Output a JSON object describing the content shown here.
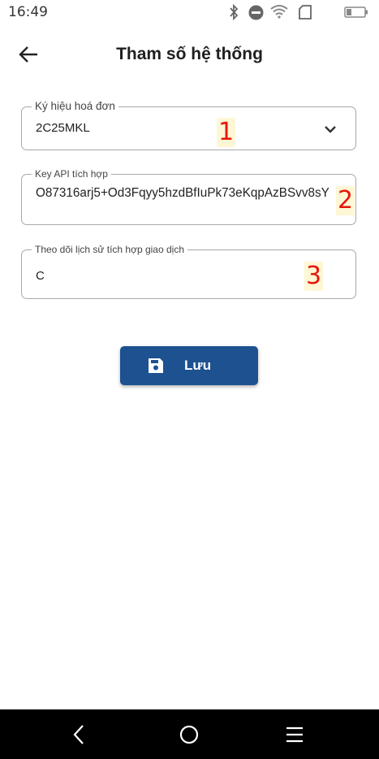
{
  "status_bar": {
    "time": "16:49",
    "icons": [
      "bluetooth-icon",
      "do-not-disturb-icon",
      "wifi-icon",
      "sim-card-icon",
      "battery-icon"
    ]
  },
  "header": {
    "title": "Tham số hệ thống",
    "back_icon": "arrow-left-icon"
  },
  "form": {
    "invoice_symbol": {
      "label": "Ký hiệu hoá đơn",
      "value": "2C25MKL",
      "icon": "chevron-down-icon"
    },
    "api_key": {
      "label": "Key API tích hợp",
      "value": "O87316arj5+Od3Fqyy5hzdBfIuPk73eKqpAzBSvv8sY"
    },
    "transaction_history": {
      "label": "Theo dõi lịch sử tích hợp giao dịch",
      "value": "C"
    }
  },
  "annotations": [
    "1",
    "2",
    "3"
  ],
  "save_button": {
    "label": "Lưu",
    "icon": "floppy-disk-icon"
  },
  "nav_bar": {
    "icons": [
      "back-nav-icon",
      "home-nav-icon",
      "menu-nav-icon"
    ]
  },
  "colors": {
    "primary": "#1d5190",
    "annotation": "#e8160a",
    "annotation_bg": "#fdf7d5",
    "nav_bar": "#000000"
  }
}
